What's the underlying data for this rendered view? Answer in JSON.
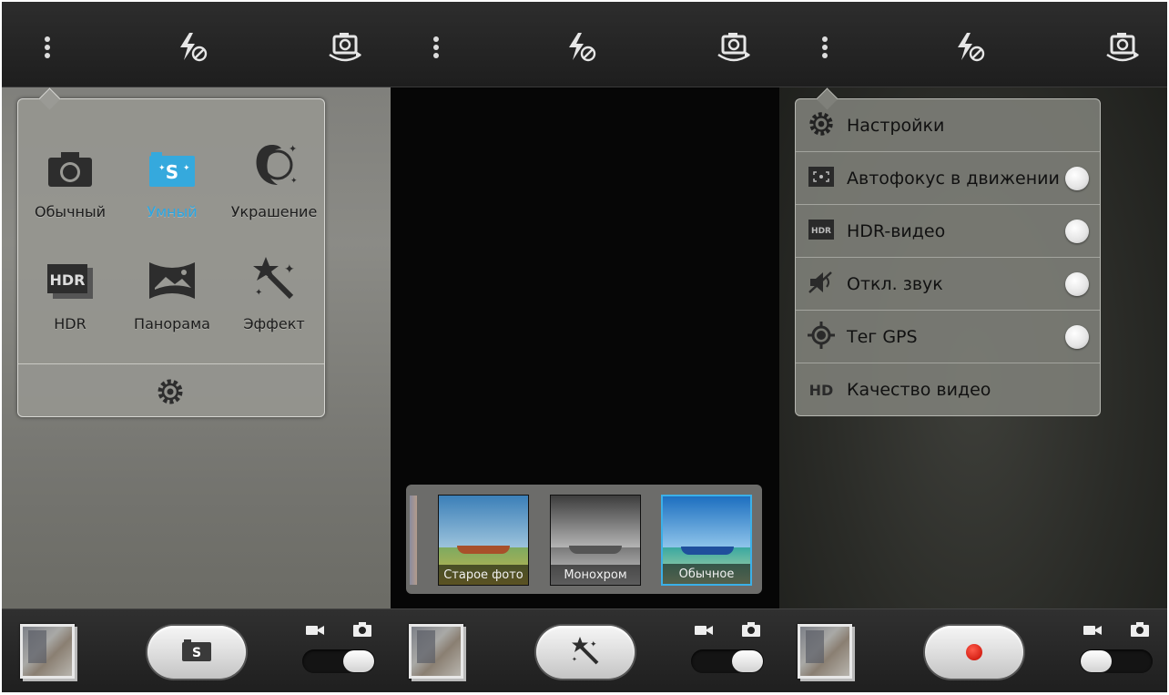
{
  "screen1": {
    "topbar": {
      "menu_icon": "overflow-menu-icon",
      "flash_icon": "flash-off-icon",
      "switch_icon": "switch-camera-icon"
    },
    "modes": [
      {
        "label": "Обычный",
        "icon": "camera-icon",
        "active": false
      },
      {
        "label": "Умный",
        "icon": "smart-camera-icon",
        "active": true
      },
      {
        "label": "Украшение",
        "icon": "beauty-face-icon",
        "active": false
      },
      {
        "label": "HDR",
        "icon": "hdr-icon",
        "active": false
      },
      {
        "label": "Панорама",
        "icon": "panorama-icon",
        "active": false
      },
      {
        "label": "Эффект",
        "icon": "magic-wand-icon",
        "active": false
      }
    ],
    "settings_icon": "gear-icon",
    "shutter_icon": "smart-camera-icon",
    "mode_switch": "photo"
  },
  "screen2": {
    "filters": [
      {
        "label": "Старое фото",
        "selected": false,
        "style": "vintage"
      },
      {
        "label": "Монохром",
        "selected": false,
        "style": "mono"
      },
      {
        "label": "Обычное",
        "selected": true,
        "style": "normal"
      }
    ],
    "shutter_icon": "magic-wand-icon",
    "mode_switch": "photo",
    "accent_color": "#3bb0e8"
  },
  "screen3": {
    "settings": [
      {
        "label": "Настройки",
        "icon": "gear-icon",
        "toggle": false
      },
      {
        "label": "Автофокус в движении",
        "icon": "motion-focus-icon",
        "toggle": true
      },
      {
        "label": "HDR-видео",
        "icon": "hdr-video-icon",
        "toggle": true
      },
      {
        "label": "Откл. звук",
        "icon": "mute-icon",
        "toggle": true
      },
      {
        "label": "Тег GPS",
        "icon": "gps-icon",
        "toggle": true
      },
      {
        "label": "Качество видео",
        "icon_text": "HD",
        "icon": "hd-icon",
        "toggle": false
      }
    ],
    "shutter_icon": "record-icon",
    "mode_switch": "video",
    "record_color": "#e0160a"
  }
}
